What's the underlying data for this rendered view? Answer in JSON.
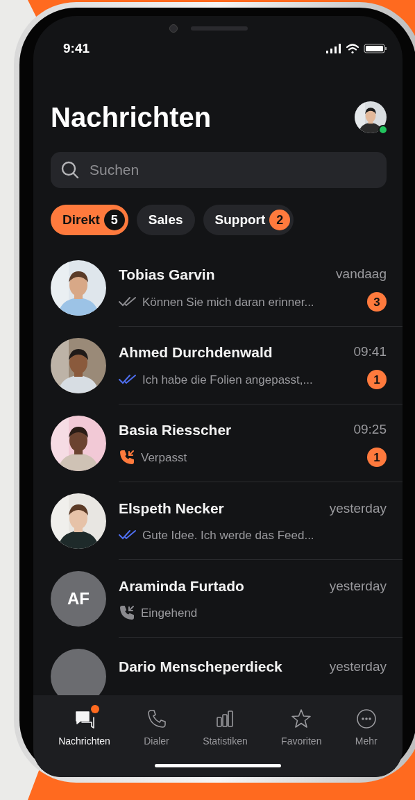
{
  "status_bar": {
    "time": "9:41"
  },
  "header": {
    "title": "Nachrichten",
    "profile": {
      "kind": "picture",
      "online": true
    }
  },
  "search": {
    "placeholder": "Suchen"
  },
  "tabs": [
    {
      "label": "Direkt",
      "count": "5",
      "selected": true
    },
    {
      "label": "Sales",
      "selected": false
    },
    {
      "label": "Support",
      "count": "2",
      "selected": false
    }
  ],
  "conversations": [
    {
      "avatar": {
        "kind": "picture"
      },
      "name": "Tobias Garvin",
      "time": "vandaag",
      "preview": {
        "kind": "message",
        "read": false,
        "text": "Können Sie mich daran erinner..."
      },
      "unread": "3"
    },
    {
      "avatar": {
        "kind": "picture"
      },
      "name": "Ahmed Durchdenwald",
      "time": "09:41",
      "preview": {
        "kind": "message",
        "read": true,
        "text": "Ich habe die Folien angepasst,..."
      },
      "unread": "1"
    },
    {
      "avatar": {
        "kind": "picture"
      },
      "name": "Basia Riesscher",
      "time": "09:25",
      "preview": {
        "kind": "missed_call",
        "text": "Verpasst"
      },
      "unread": "1"
    },
    {
      "avatar": {
        "kind": "picture"
      },
      "name": "Elspeth Necker",
      "time": "yesterday",
      "preview": {
        "kind": "message",
        "read": true,
        "text": "Gute Idee. Ich werde das Feed..."
      }
    },
    {
      "avatar": {
        "kind": "initials",
        "initials": "AF"
      },
      "name": "Araminda Furtado",
      "time": "yesterday",
      "preview": {
        "kind": "incoming_call",
        "text": "Eingehend"
      }
    },
    {
      "avatar": {
        "kind": "blank"
      },
      "name": "Dario Menscheperdieck",
      "time": "yesterday"
    }
  ],
  "nav": [
    {
      "kind": "messages",
      "label": "Nachrichten",
      "selected": true,
      "badge": true
    },
    {
      "kind": "phone",
      "label": "Dialer",
      "selected": false,
      "badge": false
    },
    {
      "kind": "stats",
      "label": "Statistiken",
      "selected": false,
      "badge": false
    },
    {
      "kind": "star",
      "label": "Favoriten",
      "selected": false,
      "badge": false
    },
    {
      "kind": "more",
      "label": "Mehr",
      "selected": false,
      "badge": false
    }
  ]
}
